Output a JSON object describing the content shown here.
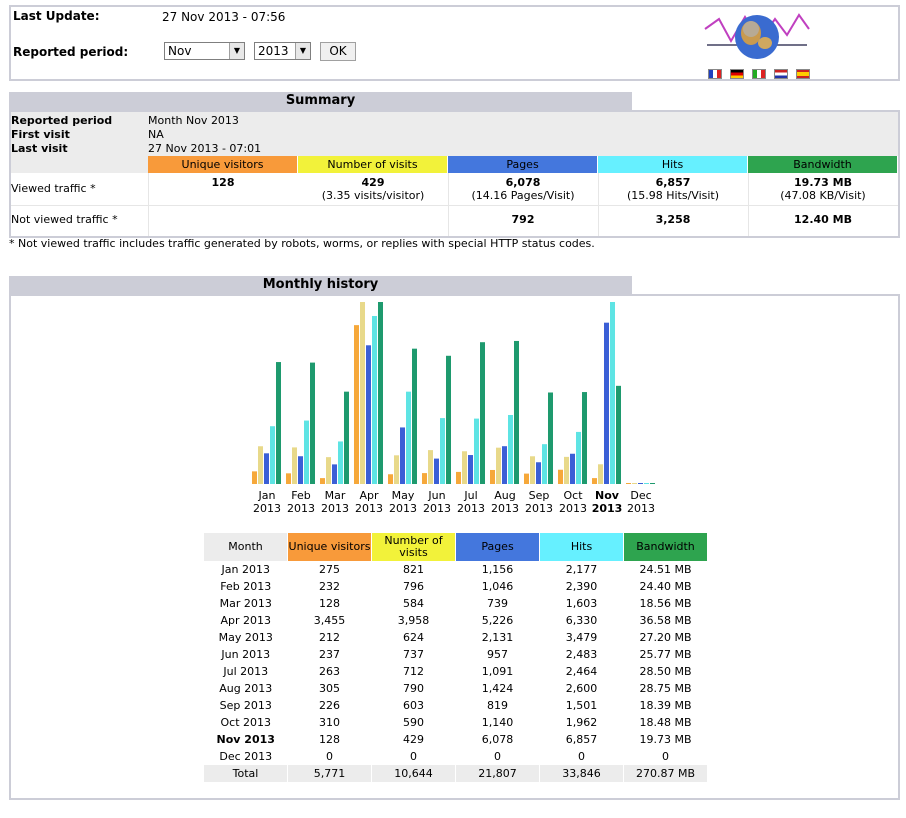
{
  "header": {
    "last_update_label": "Last Update:",
    "last_update_value": "27 Nov 2013 - 07:56",
    "reported_period_label": "Reported period:",
    "month_select": "Nov",
    "year_select": "2013",
    "ok_label": "OK"
  },
  "summary": {
    "title": "Summary",
    "reported_period_label": "Reported period",
    "reported_period_value": "Month Nov 2013",
    "first_visit_label": "First visit",
    "first_visit_value": "NA",
    "last_visit_label": "Last visit",
    "last_visit_value": "27 Nov 2013 - 07:01",
    "columns": [
      "Unique visitors",
      "Number of visits",
      "Pages",
      "Hits",
      "Bandwidth"
    ],
    "viewed_label": "Viewed traffic *",
    "viewed": {
      "unique": "128",
      "visits": "429",
      "visits_sub": "(3.35 visits/visitor)",
      "pages": "6,078",
      "pages_sub": "(14.16 Pages/Visit)",
      "hits": "6,857",
      "hits_sub": "(15.98 Hits/Visit)",
      "bandwidth": "19.73 MB",
      "bandwidth_sub": "(47.08 KB/Visit)"
    },
    "not_viewed_label": "Not viewed traffic *",
    "not_viewed": {
      "pages": "792",
      "hits": "3,258",
      "bandwidth": "12.40 MB"
    },
    "footnote": "* Not viewed traffic includes traffic generated by robots, worms, or replies with special HTTP status codes."
  },
  "history": {
    "title": "Monthly history",
    "columns": [
      "Month",
      "Unique visitors",
      "Number of visits",
      "Pages",
      "Hits",
      "Bandwidth"
    ],
    "rows": [
      {
        "month": "Jan 2013",
        "unique": "275",
        "visits": "821",
        "pages": "1,156",
        "hits": "2,177",
        "bandwidth": "24.51 MB"
      },
      {
        "month": "Feb 2013",
        "unique": "232",
        "visits": "796",
        "pages": "1,046",
        "hits": "2,390",
        "bandwidth": "24.40 MB"
      },
      {
        "month": "Mar 2013",
        "unique": "128",
        "visits": "584",
        "pages": "739",
        "hits": "1,603",
        "bandwidth": "18.56 MB"
      },
      {
        "month": "Apr 2013",
        "unique": "3,455",
        "visits": "3,958",
        "pages": "5,226",
        "hits": "6,330",
        "bandwidth": "36.58 MB"
      },
      {
        "month": "May 2013",
        "unique": "212",
        "visits": "624",
        "pages": "2,131",
        "hits": "3,479",
        "bandwidth": "27.20 MB"
      },
      {
        "month": "Jun 2013",
        "unique": "237",
        "visits": "737",
        "pages": "957",
        "hits": "2,483",
        "bandwidth": "25.77 MB"
      },
      {
        "month": "Jul 2013",
        "unique": "263",
        "visits": "712",
        "pages": "1,091",
        "hits": "2,464",
        "bandwidth": "28.50 MB"
      },
      {
        "month": "Aug 2013",
        "unique": "305",
        "visits": "790",
        "pages": "1,424",
        "hits": "2,600",
        "bandwidth": "28.75 MB"
      },
      {
        "month": "Sep 2013",
        "unique": "226",
        "visits": "603",
        "pages": "819",
        "hits": "1,501",
        "bandwidth": "18.39 MB"
      },
      {
        "month": "Oct 2013",
        "unique": "310",
        "visits": "590",
        "pages": "1,140",
        "hits": "1,962",
        "bandwidth": "18.48 MB"
      },
      {
        "month": "Nov 2013",
        "unique": "128",
        "visits": "429",
        "pages": "6,078",
        "hits": "6,857",
        "bandwidth": "19.73 MB"
      },
      {
        "month": "Dec 2013",
        "unique": "0",
        "visits": "0",
        "pages": "0",
        "hits": "0",
        "bandwidth": "0"
      }
    ],
    "total": {
      "month": "Total",
      "unique": "5,771",
      "visits": "10,644",
      "pages": "21,807",
      "hits": "33,846",
      "bandwidth": "270.87 MB"
    }
  },
  "chart_data": {
    "type": "bar",
    "categories": [
      "Jan 2013",
      "Feb 2013",
      "Mar 2013",
      "Apr 2013",
      "May 2013",
      "Jun 2013",
      "Jul 2013",
      "Aug 2013",
      "Sep 2013",
      "Oct 2013",
      "Nov 2013",
      "Dec 2013"
    ],
    "tick_months": [
      "Jan",
      "Feb",
      "Mar",
      "Apr",
      "May",
      "Jun",
      "Jul",
      "Aug",
      "Sep",
      "Oct",
      "Nov",
      "Dec"
    ],
    "tick_year": "2013",
    "highlight": "Nov 2013",
    "series": [
      {
        "name": "Unique visitors",
        "color": "#f6a83a",
        "values": [
          275,
          232,
          128,
          3455,
          212,
          237,
          263,
          305,
          226,
          310,
          128,
          0
        ]
      },
      {
        "name": "Number of visits",
        "color": "#e8d98a",
        "values": [
          821,
          796,
          584,
          3958,
          624,
          737,
          712,
          790,
          603,
          590,
          429,
          0
        ]
      },
      {
        "name": "Pages",
        "color": "#3b5fd6",
        "values": [
          1156,
          1046,
          739,
          5226,
          2131,
          957,
          1091,
          1424,
          819,
          1140,
          6078,
          0
        ]
      },
      {
        "name": "Hits",
        "color": "#5ee4e4",
        "values": [
          2177,
          2390,
          1603,
          6330,
          3479,
          2483,
          2464,
          2600,
          1501,
          1962,
          6857,
          0
        ]
      },
      {
        "name": "Bandwidth",
        "color": "#1e9a6e",
        "values": [
          24.51,
          24.4,
          18.56,
          36.58,
          27.2,
          25.77,
          28.5,
          28.75,
          18.39,
          18.48,
          19.73,
          0
        ]
      }
    ],
    "colors": {
      "unique": "#f89a3a",
      "visits": "#f2f23a",
      "pages": "#4477dd",
      "hits": "#66f0ff",
      "bandwidth": "#2ea44f"
    }
  }
}
